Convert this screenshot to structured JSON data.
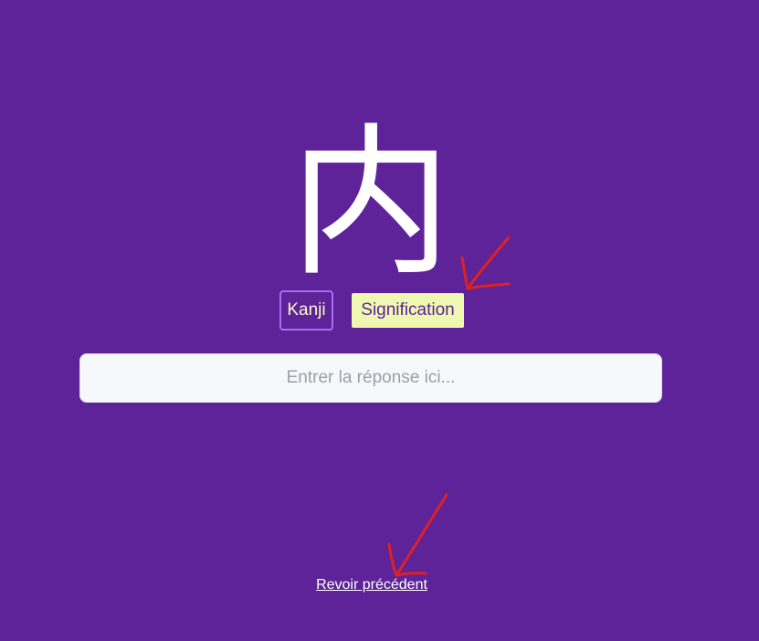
{
  "card": {
    "kanji": "内"
  },
  "mode_tags": {
    "kanji_label": "Kanji",
    "signification_label": "Signification"
  },
  "answer": {
    "placeholder": "Entrer la réponse ici...",
    "value": ""
  },
  "footer": {
    "review_previous_label": "Revoir précédent"
  },
  "colors": {
    "background": "#5e2399",
    "signification_bg": "#eef8b0",
    "kanji_tag_border": "#a66ef2",
    "annotation_arrow": "#e02020"
  }
}
